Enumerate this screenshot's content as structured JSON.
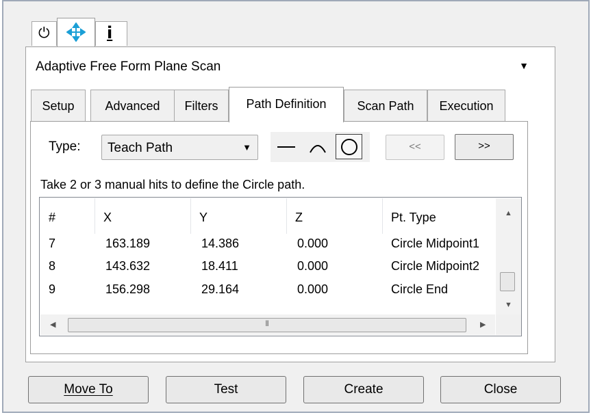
{
  "icon_tabs": [
    {
      "icon": "power-icon",
      "glyph": "⏻"
    },
    {
      "icon": "move-arrows-icon",
      "glyph": "✥"
    },
    {
      "icon": "info-icon",
      "glyph": "i"
    }
  ],
  "scan_type": {
    "value": "Adaptive Free Form Plane Scan"
  },
  "tabs": [
    "Setup",
    "Advanced",
    "Filters",
    "Path Definition",
    "Scan Path",
    "Execution"
  ],
  "active_tab": "Path Definition",
  "path": {
    "type_label": "Type:",
    "type_value": "Teach Path",
    "shapes": [
      "line-icon",
      "arc-icon",
      "circle-icon"
    ],
    "selected_shape": "circle-icon",
    "prev_label": "<<",
    "next_label": ">>",
    "instruction": "Take 2 or 3 manual hits to define the Circle path."
  },
  "table": {
    "headers": [
      "#",
      "X",
      "Y",
      "Z",
      "Pt. Type"
    ],
    "rows": [
      [
        "7",
        "163.189",
        "14.386",
        "0.000",
        "Circle Midpoint1"
      ],
      [
        "8",
        "143.632",
        "18.411",
        "0.000",
        "Circle Midpoint2"
      ],
      [
        "9",
        "156.298",
        "29.164",
        "0.000",
        "Circle End"
      ]
    ]
  },
  "buttons": {
    "move_to": "Move To",
    "test": "Test",
    "create": "Create",
    "close": "Close"
  },
  "colors": {
    "accent": "#1b9fd6",
    "frame": "#9fa9b8"
  }
}
